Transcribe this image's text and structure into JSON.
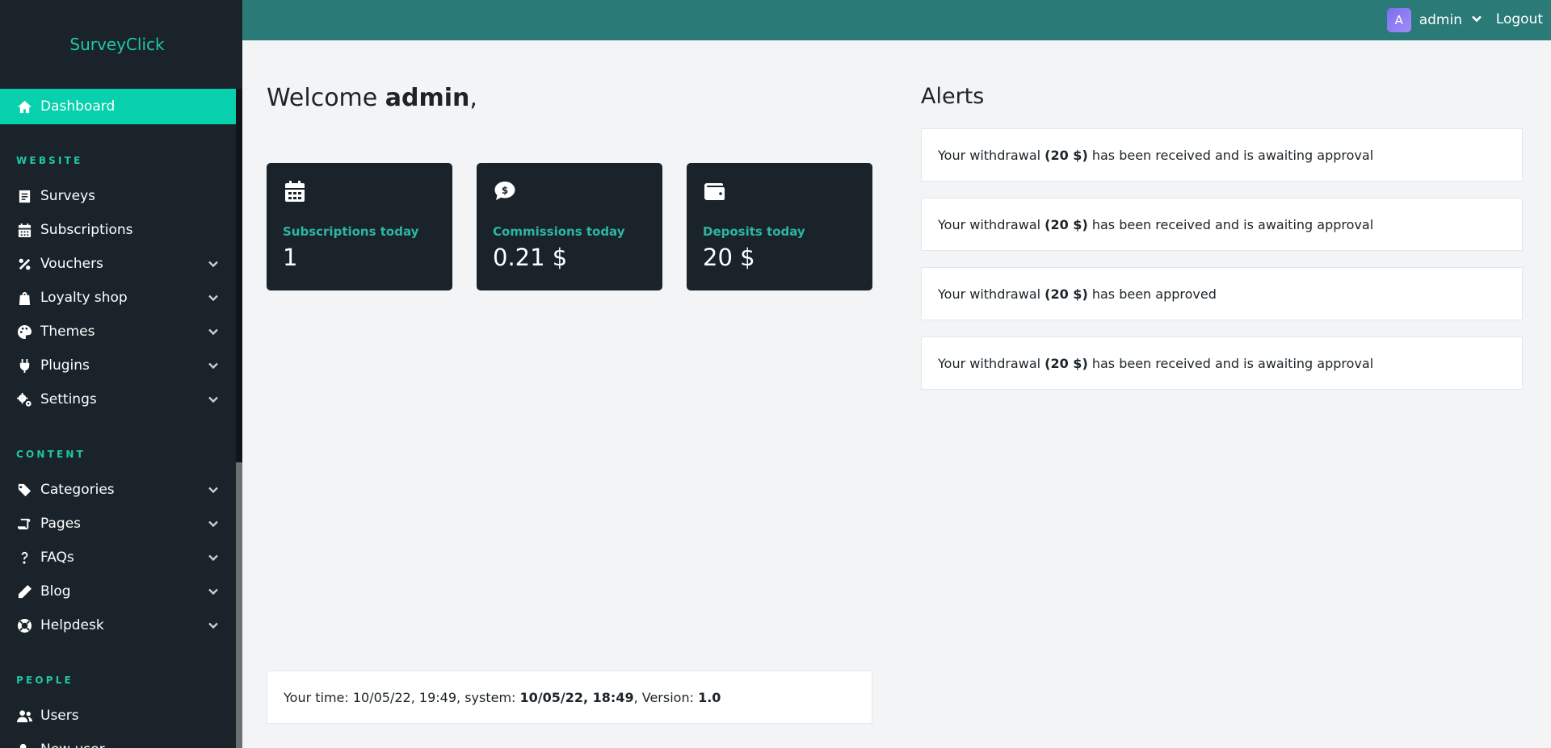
{
  "app": {
    "brand": "SurveyClick"
  },
  "sidebar": {
    "dashboard": {
      "label": "Dashboard",
      "icon": "home-icon"
    },
    "sections": [
      {
        "title": "WEBSITE",
        "items": [
          {
            "label": "Surveys",
            "icon": "survey-icon",
            "expandable": false
          },
          {
            "label": "Subscriptions",
            "icon": "calendar-icon",
            "expandable": false
          },
          {
            "label": "Vouchers",
            "icon": "percent-icon",
            "expandable": true
          },
          {
            "label": "Loyalty shop",
            "icon": "shopping-bag-icon",
            "expandable": true
          },
          {
            "label": "Themes",
            "icon": "palette-icon",
            "expandable": true
          },
          {
            "label": "Plugins",
            "icon": "plug-icon",
            "expandable": true
          },
          {
            "label": "Settings",
            "icon": "gears-icon",
            "expandable": true
          }
        ]
      },
      {
        "title": "CONTENT",
        "items": [
          {
            "label": "Categories",
            "icon": "tags-icon",
            "expandable": true
          },
          {
            "label": "Pages",
            "icon": "scroll-icon",
            "expandable": true
          },
          {
            "label": "FAQs",
            "icon": "question-icon",
            "expandable": true
          },
          {
            "label": "Blog",
            "icon": "pencil-icon",
            "expandable": true
          },
          {
            "label": "Helpdesk",
            "icon": "life-ring-icon",
            "expandable": true
          }
        ]
      },
      {
        "title": "PEOPLE",
        "items": [
          {
            "label": "Users",
            "icon": "users-icon",
            "expandable": false
          },
          {
            "label": "New user",
            "icon": "user-plus-icon",
            "expandable": false
          }
        ]
      }
    ]
  },
  "topbar": {
    "avatar_letter": "A",
    "username": "admin",
    "logout": "Logout"
  },
  "welcome": {
    "prefix": "Welcome ",
    "name": "admin",
    "suffix": ","
  },
  "stats": [
    {
      "label": "Subscriptions today",
      "value": "1",
      "icon": "calendar-icon"
    },
    {
      "label": "Commissions today",
      "value": "0.21 $",
      "icon": "dollar-comment-icon"
    },
    {
      "label": "Deposits today",
      "value": "20 $",
      "icon": "wallet-icon"
    }
  ],
  "alerts": {
    "title": "Alerts",
    "items": [
      {
        "prefix": "Your withdrawal ",
        "amount": "(20 $)",
        "suffix": " has been received and is awaiting approval"
      },
      {
        "prefix": "Your withdrawal ",
        "amount": "(20 $)",
        "suffix": " has been received and is awaiting approval"
      },
      {
        "prefix": "Your withdrawal ",
        "amount": "(20 $)",
        "suffix": " has been approved"
      },
      {
        "prefix": "Your withdrawal ",
        "amount": "(20 $)",
        "suffix": " has been received and is awaiting approval"
      }
    ]
  },
  "footer": {
    "your_time_label": "Your time: ",
    "your_time": "10/05/22, 19:49",
    "system_label": ", system: ",
    "system_time": "10/05/22, 18:49",
    "version_label": ", Version: ",
    "version": "1.0"
  },
  "colors": {
    "accent": "#06d1ac",
    "sidebar_bg": "#192329",
    "topbar_bg": "#2a7a78",
    "brand_text": "#1fc7a6"
  }
}
